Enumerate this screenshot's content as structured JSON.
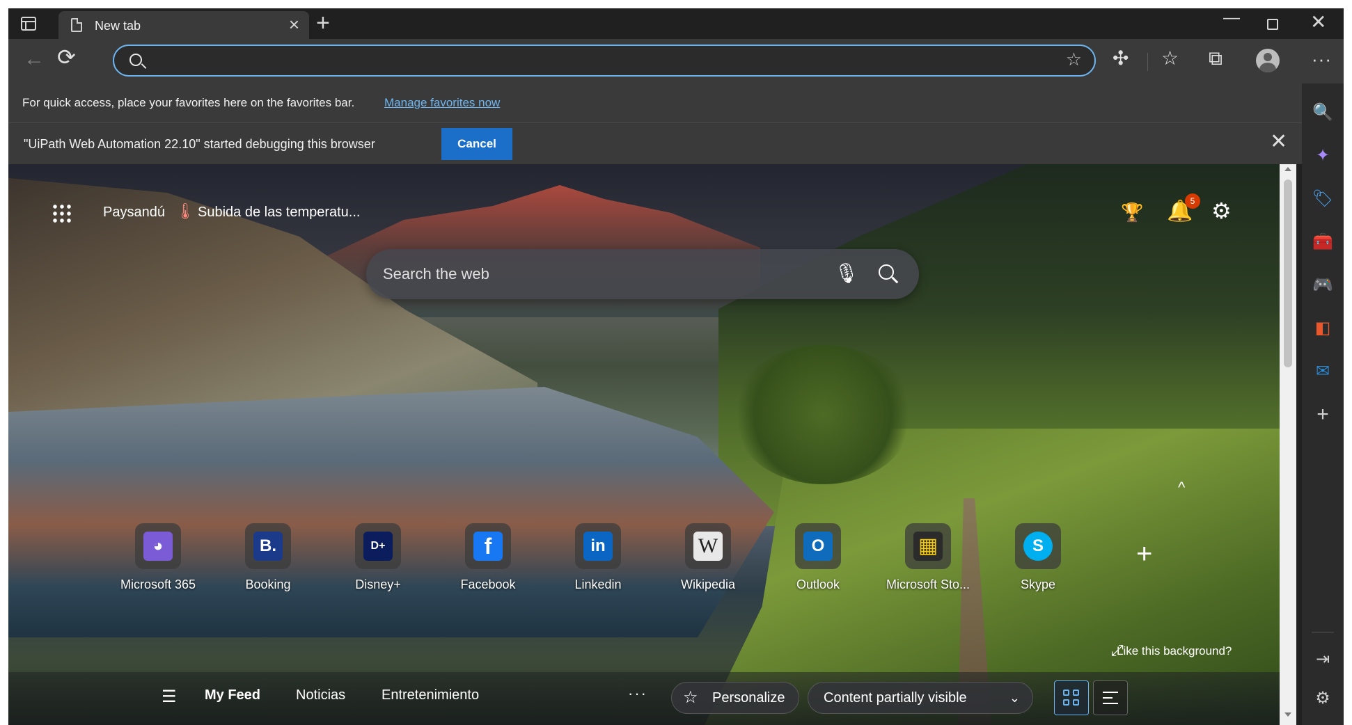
{
  "tab": {
    "title": "New tab",
    "close": "×",
    "new_tab": "+"
  },
  "window_controls": {
    "minimize": "—",
    "close": "✕"
  },
  "toolbar": {
    "back": "←",
    "refresh": "⟳",
    "address_value": "",
    "address_placeholder": "",
    "add_favorite": "☆",
    "extensions": "✣",
    "favorites": "☆",
    "collections": "⧉",
    "more": "···"
  },
  "favorites_hint": {
    "text": "For quick access, place your favorites here on the favorites bar.",
    "link": "Manage favorites now"
  },
  "debug_bar": {
    "text": "\"UiPath Web Automation 22.10\" started debugging this browser",
    "cancel": "Cancel",
    "close": "✕"
  },
  "header": {
    "location": "Paysandú",
    "weather_icon": "🌡",
    "weather_alert": "Subida de las temperatu...",
    "rewards": "🏆",
    "notifications": "🔔",
    "notification_count": "5",
    "settings": "⚙"
  },
  "search": {
    "placeholder": "Search the web",
    "mic": "🎙"
  },
  "quick_links": [
    {
      "label": "Microsoft 365",
      "glyph": "◕",
      "color": "#7b5cd6"
    },
    {
      "label": "Booking",
      "glyph": "B.",
      "color": "#1c3a8a"
    },
    {
      "label": "Disney+",
      "glyph": "D+",
      "color": "#0b1d5c"
    },
    {
      "label": "Facebook",
      "glyph": "f",
      "color": "#1877f2"
    },
    {
      "label": "Linkedin",
      "glyph": "in",
      "color": "#0a66c2"
    },
    {
      "label": "Wikipedia",
      "glyph": "W",
      "color": "#e8e8e8"
    },
    {
      "label": "Outlook",
      "glyph": "O",
      "color": "#0f6cbd"
    },
    {
      "label": "Microsoft Sto...",
      "glyph": "▦",
      "color": "#2b2b2b"
    },
    {
      "label": "Skype",
      "glyph": "S",
      "color": "#00aff0"
    }
  ],
  "add_shortcut": "+",
  "collapse": "^",
  "like_background": {
    "icon": "⤢",
    "text": "Like this background?"
  },
  "feed": {
    "menu": "☰",
    "tabs": [
      "My Feed",
      "Noticias",
      "Entretenimiento"
    ],
    "more": "···",
    "personalize_icon": "☆",
    "personalize": "Personalize",
    "content_visibility": "Content partially visible",
    "chevron": "⌄"
  },
  "sidebar": {
    "search": "🔍",
    "copilot": "✦",
    "shopping": "🏷",
    "tools": "🧰",
    "games": "🎮",
    "office": "◧",
    "outlook": "✉",
    "add": "+",
    "hide": "⇥",
    "settings": "⚙"
  },
  "colors": {
    "accent": "#6cb4ef",
    "cancel_button": "#1b6fc8",
    "badge": "#d83b01"
  }
}
